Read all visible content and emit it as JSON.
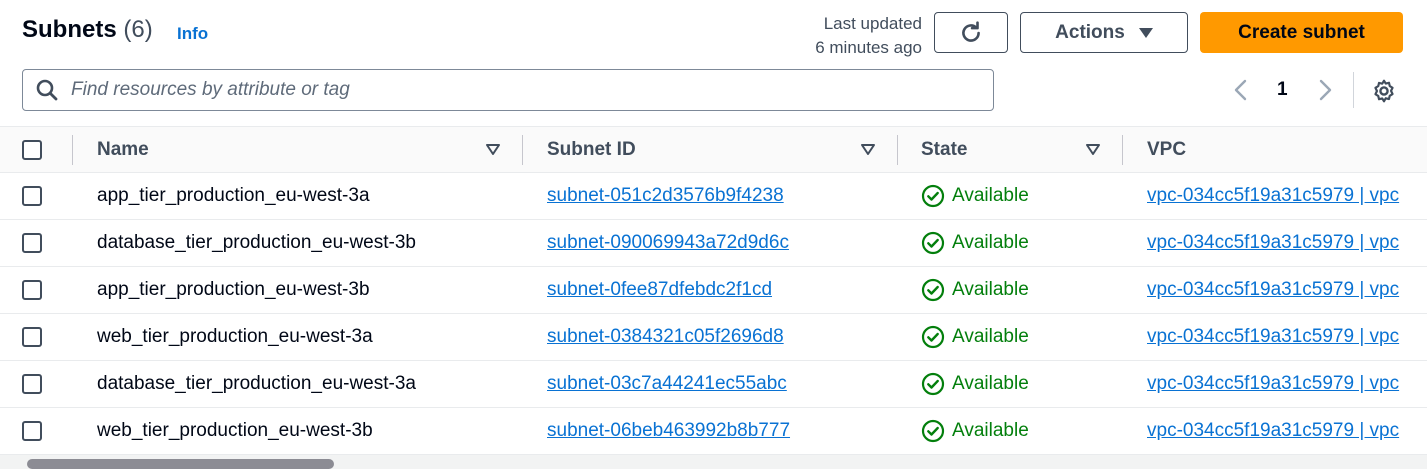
{
  "header": {
    "title": "Subnets",
    "count": "(6)",
    "info_label": "Info",
    "last_updated_line1": "Last updated",
    "last_updated_line2": "6 minutes ago",
    "actions_label": "Actions",
    "create_label": "Create subnet"
  },
  "search": {
    "placeholder": "Find resources by attribute or tag",
    "value": ""
  },
  "pagination": {
    "current_page": "1"
  },
  "table": {
    "columns": [
      "Name",
      "Subnet ID",
      "State",
      "VPC"
    ],
    "rows": [
      {
        "name": "app_tier_production_eu-west-3a",
        "subnet_id": "subnet-051c2d3576b9f4238",
        "state": "Available",
        "vpc": "vpc-034cc5f19a31c5979 | vpc"
      },
      {
        "name": "database_tier_production_eu-west-3b",
        "subnet_id": "subnet-090069943a72d9d6c",
        "state": "Available",
        "vpc": "vpc-034cc5f19a31c5979 | vpc"
      },
      {
        "name": "app_tier_production_eu-west-3b",
        "subnet_id": "subnet-0fee87dfebdc2f1cd",
        "state": "Available",
        "vpc": "vpc-034cc5f19a31c5979 | vpc"
      },
      {
        "name": "web_tier_production_eu-west-3a",
        "subnet_id": "subnet-0384321c05f2696d8",
        "state": "Available",
        "vpc": "vpc-034cc5f19a31c5979 | vpc"
      },
      {
        "name": "database_tier_production_eu-west-3a",
        "subnet_id": "subnet-03c7a44241ec55abc",
        "state": "Available",
        "vpc": "vpc-034cc5f19a31c5979 | vpc"
      },
      {
        "name": "web_tier_production_eu-west-3b",
        "subnet_id": "subnet-06beb463992b8b777",
        "state": "Available",
        "vpc": "vpc-034cc5f19a31c5979 | vpc"
      }
    ]
  },
  "icons": {
    "search": "search-icon",
    "refresh": "refresh-icon",
    "actions_caret": "caret-down-icon",
    "prev": "chevron-left-icon",
    "next": "chevron-right-icon",
    "settings": "gear-icon",
    "sort": "sort-caret-icon",
    "status": "check-circle-icon"
  },
  "colors": {
    "primary_button": "#ff9900",
    "link": "#0972d3",
    "success": "#037f0c",
    "text": "#000716",
    "muted": "#414d5c"
  }
}
